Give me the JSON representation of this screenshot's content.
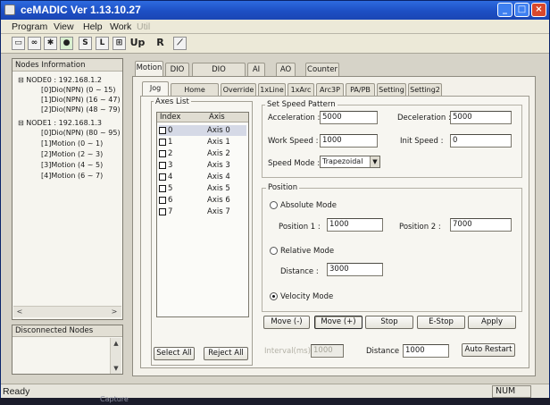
{
  "app": {
    "title": "ceMADIC Ver 1.13.10.27",
    "title_buttons": {
      "minimize": "_",
      "maximize": "□",
      "close": "×"
    }
  },
  "menu": [
    "Program",
    "View",
    "Help",
    "Work",
    "Util"
  ],
  "toolbar": {
    "buttons": [
      {
        "icon": "open-icon"
      },
      {
        "icon": "link-icon"
      },
      {
        "icon": "gear-icon"
      },
      {
        "icon": "run-icon"
      },
      {
        "icon": "s-icon",
        "label": "S"
      },
      {
        "icon": "l-icon",
        "label": "L"
      },
      {
        "icon": "grid-icon"
      },
      {
        "icon": "up-icon",
        "label": "Up"
      },
      {
        "icon": "r-icon",
        "label": "R"
      },
      {
        "icon": "chart-icon"
      }
    ]
  },
  "nodes_panel": {
    "header": "Nodes Information",
    "tree": [
      {
        "level": 0,
        "text": "NODE0 : 192.168.1.2",
        "expander": "−"
      },
      {
        "level": 1,
        "text": "[0]Dio(NPN) (0 ~ 15)"
      },
      {
        "level": 1,
        "text": "[1]Dio(NPN) (16 ~ 47)"
      },
      {
        "level": 1,
        "text": "[2]Dio(NPN) (48 ~ 79)"
      },
      {
        "level": 0,
        "text": "NODE1 : 192.168.1.3",
        "expander": "−"
      },
      {
        "level": 1,
        "text": "[0]Dio(NPN) (80 ~ 95)"
      },
      {
        "level": 1,
        "text": "[1]Motion (0 ~ 1)"
      },
      {
        "level": 1,
        "text": "[2]Motion (2 ~ 3)"
      },
      {
        "level": 1,
        "text": "[3]Motion (4 ~ 5)"
      },
      {
        "level": 1,
        "text": "[4]Motion (6 ~ 7)"
      }
    ],
    "scroll_left": "<",
    "scroll_right": ">"
  },
  "disconnected_panel": {
    "header": "Disconnected Nodes",
    "scroll_up": "▲",
    "scroll_down": "▼"
  },
  "outer_tabs": [
    "Motion",
    "DIO",
    "DIO MultiView",
    "AI",
    "AO",
    "Counter"
  ],
  "outer_active": 0,
  "inner_tabs": [
    "Jog",
    "Home Return",
    "Override",
    "1xLine",
    "1xArc",
    "Arc3P",
    "PA/PB",
    "Setting",
    "Setting2"
  ],
  "inner_active": 0,
  "axes_list": {
    "label": "Axes List",
    "col_index": "Index",
    "col_axis": "Axis",
    "rows": [
      {
        "index": "0",
        "axis": "Axis 0"
      },
      {
        "index": "1",
        "axis": "Axis 1"
      },
      {
        "index": "2",
        "axis": "Axis 2"
      },
      {
        "index": "3",
        "axis": "Axis 3"
      },
      {
        "index": "4",
        "axis": "Axis 4"
      },
      {
        "index": "5",
        "axis": "Axis 5"
      },
      {
        "index": "6",
        "axis": "Axis 6"
      },
      {
        "index": "7",
        "axis": "Axis 7"
      }
    ],
    "select_all": "Select All",
    "reject_all": "Reject All"
  },
  "speed_pattern": {
    "label": "Set Speed Pattern",
    "acceleration_label": "Acceleration :",
    "acceleration": "5000",
    "deceleration_label": "Deceleration :",
    "deceleration": "5000",
    "work_speed_label": "Work Speed :",
    "work_speed": "1000",
    "init_speed_label": "Init Speed :",
    "init_speed": "0",
    "speed_mode_label": "Speed Mode :",
    "speed_mode": "Trapezoidal"
  },
  "position": {
    "label": "Position",
    "absolute_mode": "Absolute Mode",
    "position1_label": "Position 1 :",
    "position1": "1000",
    "position2_label": "Position 2 :",
    "position2": "7000",
    "relative_mode": "Relative Mode",
    "distance_label": "Distance :",
    "distance": "3000",
    "velocity_mode": "Velocity Mode"
  },
  "actions": {
    "move_minus": "Move (-)",
    "move_plus": "Move (+)",
    "stop": "Stop",
    "estop": "E-Stop",
    "apply": "Apply"
  },
  "bottom_row": {
    "interval_label": "Interval(ms) :",
    "interval": "1000",
    "distance_label": "Distance",
    "distance": "1000",
    "auto_restart": "Auto Restart"
  },
  "status": {
    "text": "Ready",
    "num": "NUM"
  },
  "taskbar": {
    "capture": "Capture"
  }
}
